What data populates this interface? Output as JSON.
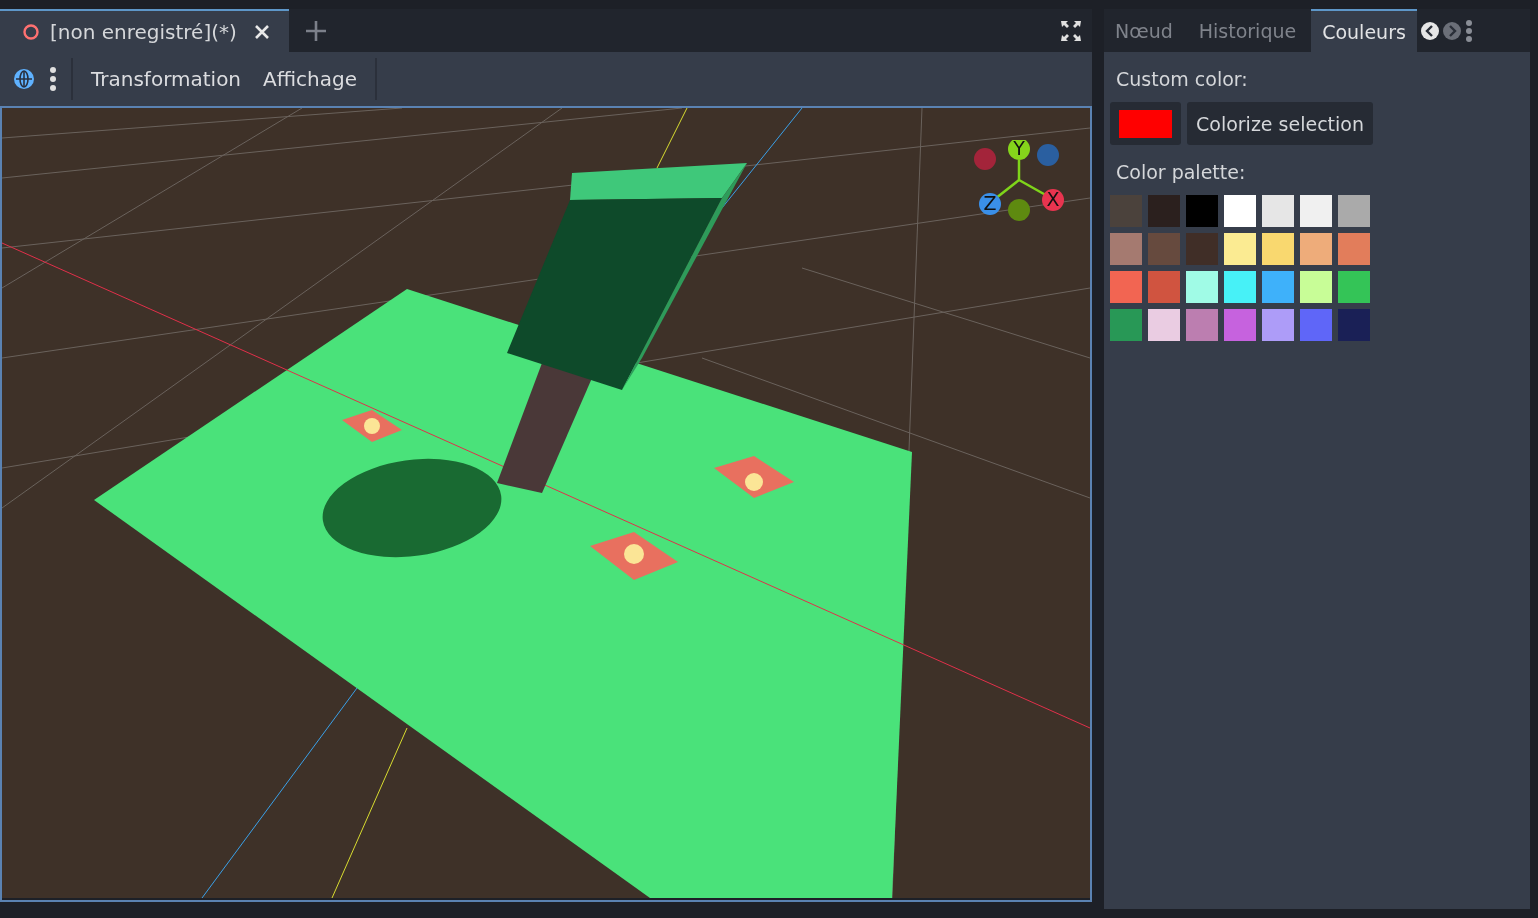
{
  "scene_tabs": [
    {
      "label": "[non enregistré](*)",
      "selected": true
    }
  ],
  "toolbar": {
    "menus": [
      "Transformation",
      "Affichage"
    ]
  },
  "gizmo": {
    "axes": [
      "Y",
      "Z",
      "X"
    ]
  },
  "dock_tabs": [
    {
      "label": "Nœud",
      "selected": false
    },
    {
      "label": "Historique",
      "selected": false
    },
    {
      "label": "Couleurs",
      "selected": true
    }
  ],
  "panel": {
    "custom_color_label": "Custom color:",
    "custom_swatch": {
      "color": "#ff0000"
    },
    "colorize_button": "Colorize selection",
    "palette_label": "Color palette:",
    "palette": [
      {
        "color": "#4b423c"
      },
      {
        "color": "#2b201e"
      },
      {
        "color": "#000000"
      },
      {
        "color": "#ffffff"
      },
      {
        "color": "#e6e6e6"
      },
      {
        "color": "#f0f0f0"
      },
      {
        "color": "#aaaaaa"
      },
      {
        "color": "#a57a70"
      },
      {
        "color": "#664a3e"
      },
      {
        "color": "#402e27"
      },
      {
        "color": "#fbeb92"
      },
      {
        "color": "#f9d86f"
      },
      {
        "color": "#eeac7a"
      },
      {
        "color": "#e27d5b"
      },
      {
        "color": "#f26552"
      },
      {
        "color": "#d05440"
      },
      {
        "color": "#a0fbe6"
      },
      {
        "color": "#47f1f7"
      },
      {
        "color": "#3eb1fa"
      },
      {
        "color": "#c8fd97"
      },
      {
        "color": "#34c457"
      },
      {
        "color": "#289856"
      },
      {
        "color": "#eacce2"
      },
      {
        "color": "#bc7eb0"
      },
      {
        "color": "#c662de"
      },
      {
        "color": "#ad9cf8"
      },
      {
        "color": "#5f66f8"
      },
      {
        "color": "#1a2056"
      }
    ]
  }
}
